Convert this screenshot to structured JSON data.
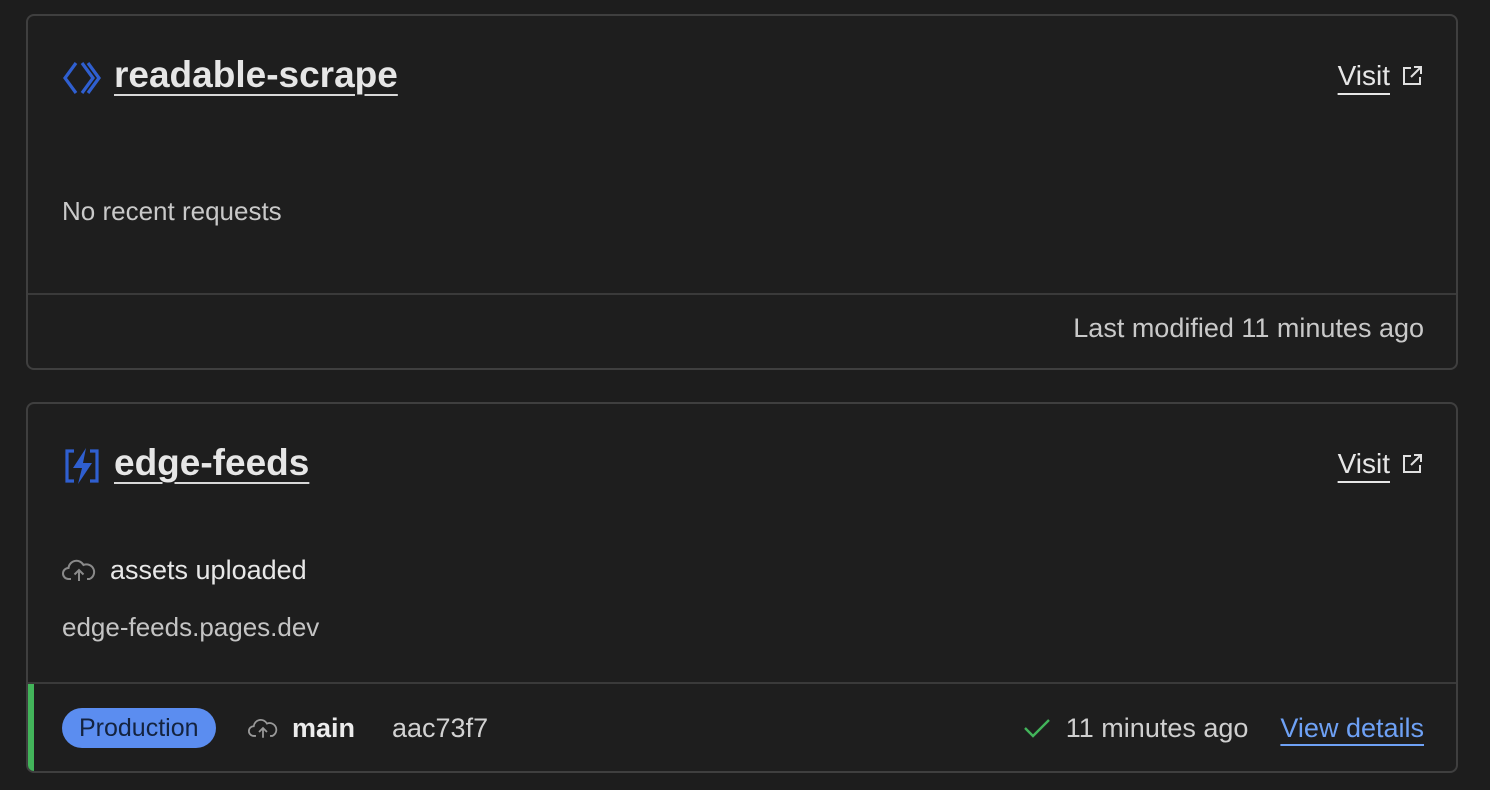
{
  "projects": [
    {
      "name": "readable-scrape",
      "icon": "code-brackets-icon",
      "visit_label": "Visit",
      "empty_message": "No recent requests",
      "last_modified": "Last modified 11 minutes ago"
    },
    {
      "name": "edge-feeds",
      "icon": "lightning-bolt-icon",
      "visit_label": "Visit",
      "status_icon": "cloud-upload-icon",
      "status_text": "assets uploaded",
      "domain": "edge-feeds.pages.dev",
      "deployment": {
        "environment": "Production",
        "branch_icon": "cloud-upload-icon",
        "branch": "main",
        "commit": "aac73f7",
        "status_icon": "check-icon",
        "time": "11 minutes ago",
        "details_label": "View details"
      }
    }
  ],
  "colors": {
    "background": "#1d1d1d",
    "card_border": "#3f3f3f",
    "icon_blue": "#2f5fd0",
    "badge_blue": "#5b8df0",
    "link_blue": "#6ea1f5",
    "success_green": "#42b45a"
  }
}
